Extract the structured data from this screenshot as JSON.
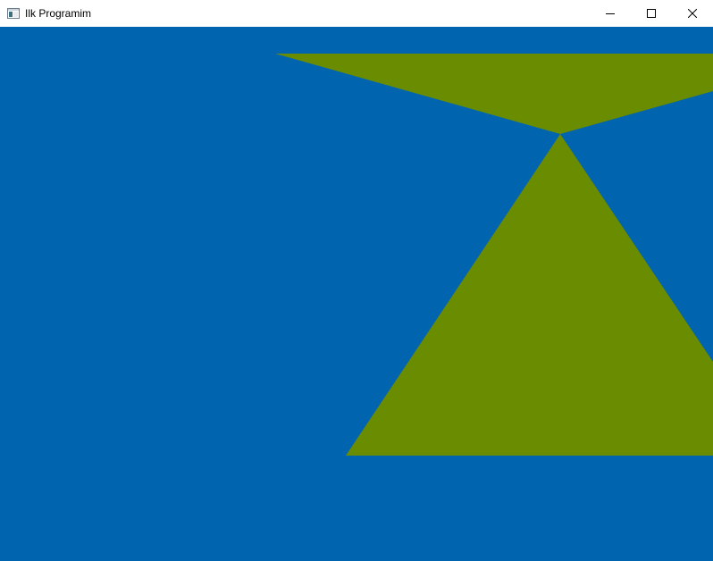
{
  "window": {
    "title": "Ilk Programim",
    "app_icon": "window-app-icon",
    "controls": {
      "minimize_icon": "minimize-icon",
      "maximize_icon": "maximize-icon",
      "close_icon": "close-icon"
    }
  },
  "scene": {
    "background_color": "#0064AF",
    "shape_color": "#6A8C00",
    "shapes": [
      "triangle",
      "triangle"
    ]
  }
}
